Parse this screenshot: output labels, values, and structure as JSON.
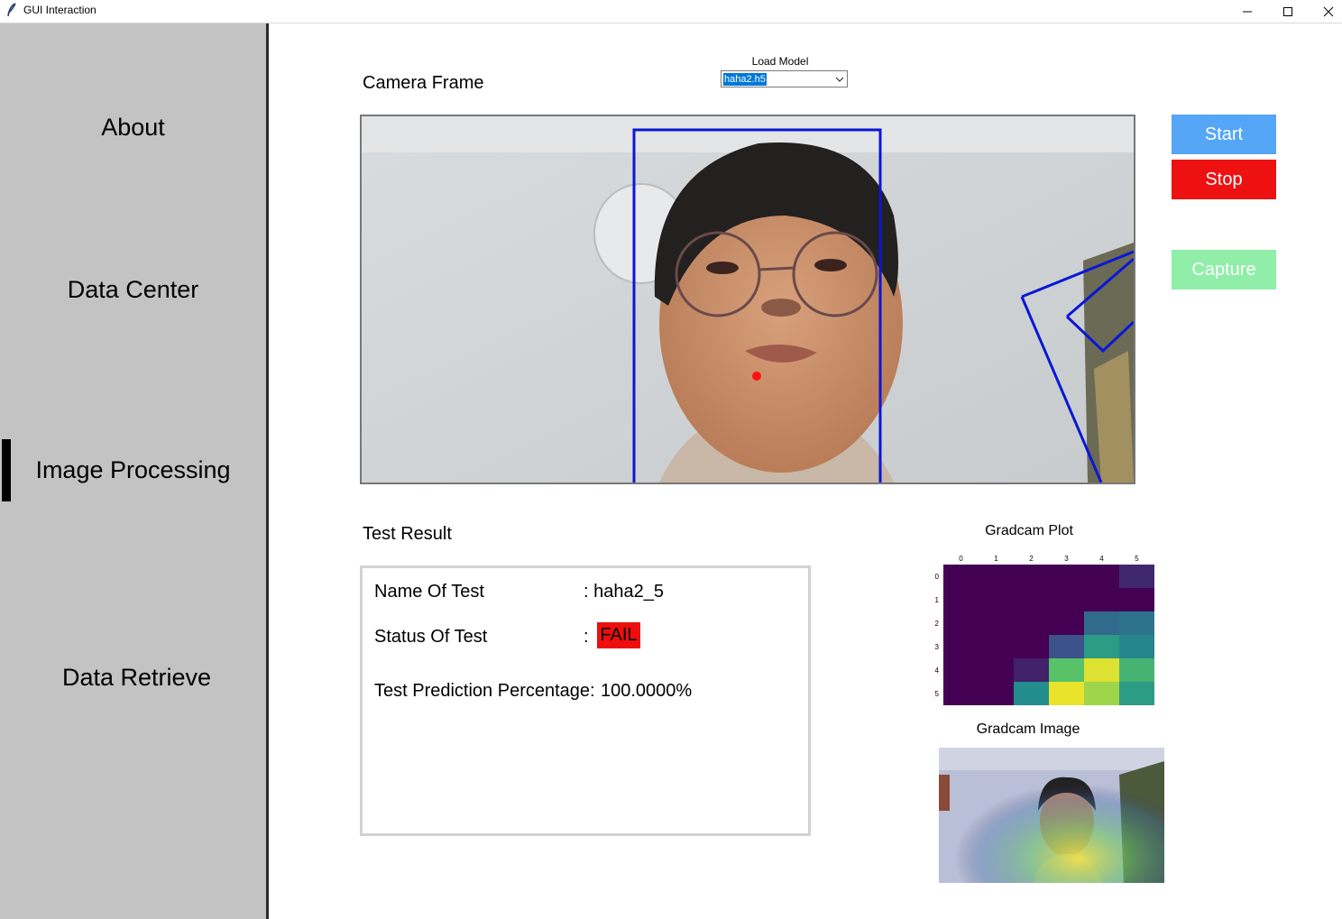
{
  "window": {
    "title": "GUI Interaction"
  },
  "sidebar": {
    "items": [
      {
        "label": "About"
      },
      {
        "label": "Data Center"
      },
      {
        "label": "Image Processing"
      },
      {
        "label": "Data Retrieve"
      }
    ],
    "active_item": "Image Processing"
  },
  "camera": {
    "title": "Camera Frame"
  },
  "load_model": {
    "label": "Load Model",
    "selected": "haha2.h5"
  },
  "controls": {
    "start_label": "Start",
    "start_color": "#55a6f7",
    "stop_label": "Stop",
    "stop_color": "#ee1111",
    "capture_label": "Capture",
    "capture_color": "#90eea8"
  },
  "test_result": {
    "title": "Test Result",
    "name_label": "Name Of Test",
    "name_value": ": haha2_5",
    "status_label": "Status Of Test",
    "status_sep": ":",
    "status_value": "FAIL",
    "status_color": "#ee0e0e",
    "prediction_label": "Test Prediction Percentage:",
    "prediction_value": "100.0000%"
  },
  "gradcam": {
    "plot_title": "Gradcam Plot",
    "image_title": "Gradcam Image"
  },
  "chart_data": {
    "type": "heatmap",
    "title": "Gradcam Plot",
    "x_ticks": [
      "0",
      "1",
      "2",
      "3",
      "4",
      "5"
    ],
    "y_ticks": [
      "0",
      "1",
      "2",
      "3",
      "4",
      "5"
    ],
    "colormap": "viridis",
    "values": [
      [
        0.0,
        0.0,
        0.0,
        0.0,
        0.0,
        0.12
      ],
      [
        0.0,
        0.0,
        0.0,
        0.0,
        0.0,
        0.0
      ],
      [
        0.0,
        0.0,
        0.0,
        0.0,
        0.35,
        0.38
      ],
      [
        0.0,
        0.0,
        0.0,
        0.25,
        0.55,
        0.45
      ],
      [
        0.0,
        0.0,
        0.1,
        0.72,
        0.95,
        0.65
      ],
      [
        0.0,
        0.0,
        0.48,
        0.97,
        0.85,
        0.55
      ]
    ]
  }
}
